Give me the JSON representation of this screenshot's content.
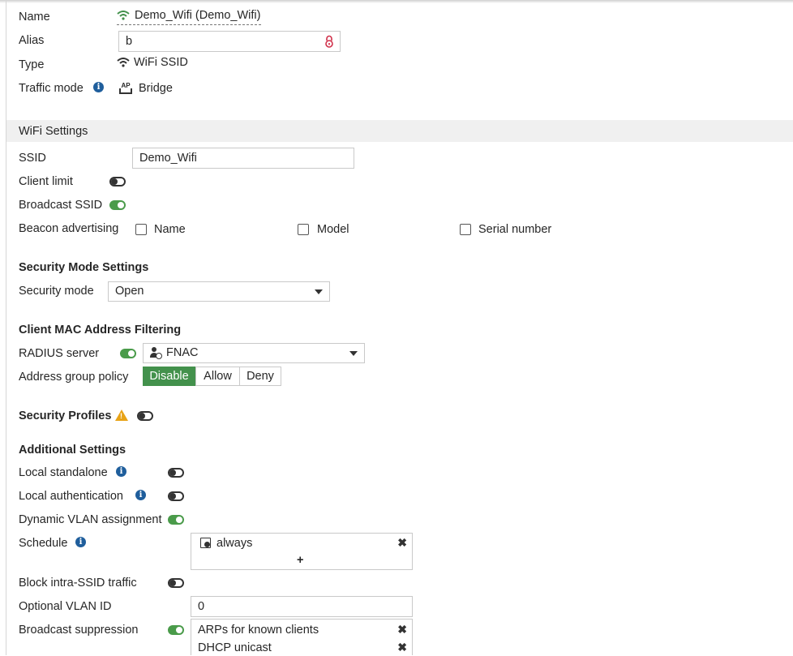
{
  "header": {
    "name_label": "Name",
    "name_value": "Demo_Wifi (Demo_Wifi)",
    "alias_label": "Alias",
    "alias_value": "b",
    "type_label": "Type",
    "type_value": "WiFi SSID",
    "traffic_mode_label": "Traffic mode",
    "traffic_mode_value": "Bridge",
    "traffic_mode_icon": "AP"
  },
  "wifi_settings": {
    "title": "WiFi Settings",
    "ssid_label": "SSID",
    "ssid_value": "Demo_Wifi",
    "client_limit_label": "Client limit",
    "client_limit_enabled": false,
    "broadcast_ssid_label": "Broadcast SSID",
    "broadcast_ssid_enabled": true,
    "beacon_label": "Beacon advertising",
    "beacon_options": [
      "Name",
      "Model",
      "Serial number"
    ]
  },
  "security_mode": {
    "title": "Security Mode Settings",
    "label": "Security mode",
    "value": "Open"
  },
  "mac_filtering": {
    "title": "Client MAC Address Filtering",
    "radius_label": "RADIUS server",
    "radius_enabled": true,
    "radius_value": "FNAC",
    "policy_label": "Address group policy",
    "policy_options": [
      "Disable",
      "Allow",
      "Deny"
    ],
    "policy_selected": "Disable"
  },
  "security_profiles": {
    "title": "Security Profiles",
    "enabled": false
  },
  "additional": {
    "title": "Additional Settings",
    "local_standalone_label": "Local standalone",
    "local_auth_label": "Local authentication",
    "dynamic_vlan_label": "Dynamic VLAN assignment",
    "schedule_label": "Schedule",
    "schedule_value": "always",
    "schedule_add": "+",
    "block_intra_label": "Block intra-SSID traffic",
    "optional_vlan_label": "Optional VLAN ID",
    "optional_vlan_value": "0",
    "broadcast_suppression_label": "Broadcast suppression",
    "broadcast_suppression_items": [
      "ARPs for known clients",
      "DHCP unicast"
    ]
  },
  "colors": {
    "accent_green": "#43914c",
    "info_blue": "#1f5e9c",
    "warning": "#e8a317",
    "lock_red": "#d0304a"
  }
}
